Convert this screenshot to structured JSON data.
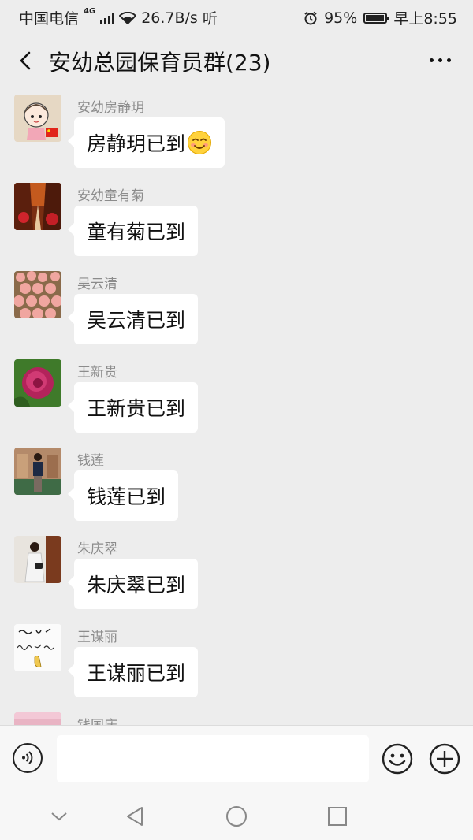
{
  "status_bar": {
    "carrier": "中国电信",
    "network_badge": "4G",
    "speed": "26.7B/s",
    "listen_text": "听",
    "battery": "95%",
    "time": "早上8:55"
  },
  "header": {
    "title": "安幼总园保育员群(23)",
    "back_icon": "chevron-left-icon",
    "more_icon": "more-dots-icon"
  },
  "messages": [
    {
      "sender": "安幼房静玥",
      "text": "房静玥已到",
      "avatar": "cartoon-girl-avatar",
      "emoji": "smiling-face-emoji"
    },
    {
      "sender": "安幼童有菊",
      "text": "童有菊已到",
      "avatar": "autumn-forest-avatar"
    },
    {
      "sender": "吴云清",
      "text": "吴云清已到",
      "avatar": "pink-flowers-avatar"
    },
    {
      "sender": "王新贵",
      "text": "王新贵已到",
      "avatar": "peony-avatar"
    },
    {
      "sender": "钱莲",
      "text": "钱莲已到",
      "avatar": "woman-photo-avatar"
    },
    {
      "sender": "朱庆翠",
      "text": "朱庆翠已到",
      "avatar": "woman-standing-avatar"
    },
    {
      "sender": "王谋丽",
      "text": "王谋丽已到",
      "avatar": "handwriting-avatar"
    },
    {
      "sender": "钱国庆",
      "text": "",
      "avatar": "pink-avatar"
    }
  ],
  "input_bar": {
    "voice_icon": "voice-icon",
    "emoji_icon": "emoji-icon",
    "plus_icon": "plus-icon",
    "input_value": ""
  },
  "nav": {
    "back_icon": "nav-back-icon",
    "home_icon": "nav-home-icon",
    "recent_icon": "nav-recent-icon",
    "down_icon": "nav-down-icon"
  }
}
